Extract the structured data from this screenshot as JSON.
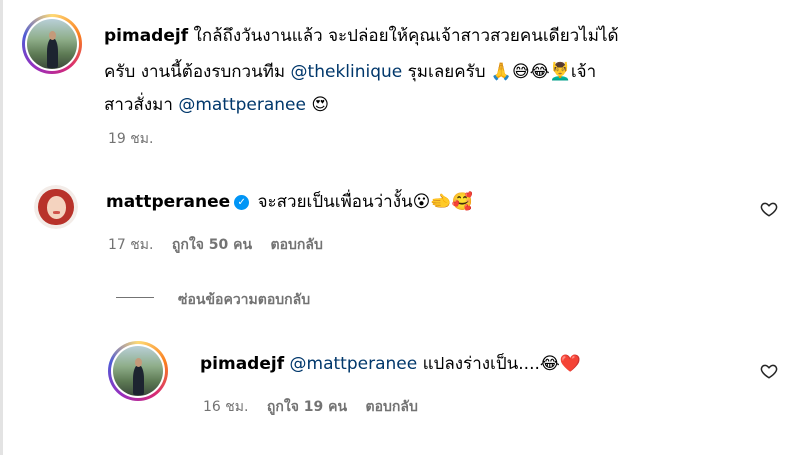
{
  "comments": [
    {
      "username": "pimadejf",
      "line1": "ใกล้ถึงวันงานแล้ว จะปล่อยให้คุณเจ้าสาวสวยคนเดียวไม่ได้",
      "line2_pre": "ครับ งานนี้ต้องรบกวนทีม ",
      "line2_mention": "@theklinique",
      "line2_post": " รุมเลยครับ 🙏😅😂💆‍♂️เจ้า",
      "line3_pre": "สาวสั่งมา ",
      "line3_mention": "@mattperanee",
      "line3_post": " 😍",
      "time": "19 ชม."
    },
    {
      "username": "mattperanee",
      "verified_icon": "✓",
      "text": "จะสวยเป็นเพื่อนว่างั้น😮🫲🥰",
      "time": "17 ชม.",
      "likes": "ถูกใจ 50 คน",
      "reply": "ตอบกลับ"
    }
  ],
  "hide_replies": "ซ่อนข้อความตอบกลับ",
  "reply_comment": {
    "username": "pimadejf",
    "mention": "@mattperanee",
    "text": " แปลงร่างเป็น....😂❤️",
    "time": "16 ชม.",
    "likes": "ถูกใจ 19 คน",
    "reply": "ตอบกลับ"
  },
  "icons": {
    "like": "heart-icon",
    "verified": "verified-badge-icon"
  }
}
